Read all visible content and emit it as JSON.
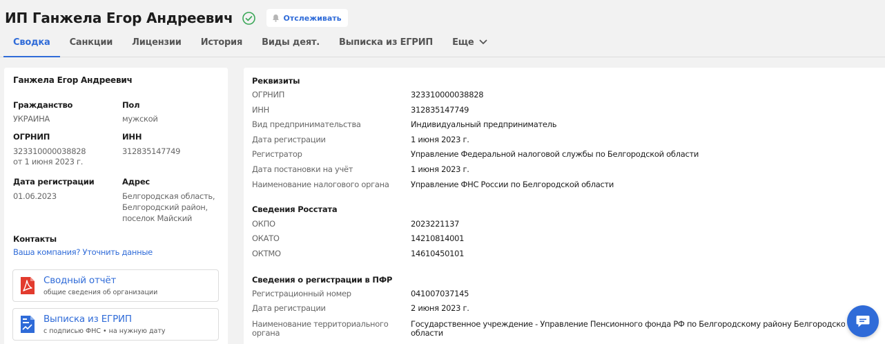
{
  "header": {
    "title": "ИП Ганжела Егор Андреевич",
    "follow_label": "Отслеживать"
  },
  "tabs": [
    {
      "label": "Сводка",
      "active": true
    },
    {
      "label": "Санкции"
    },
    {
      "label": "Лицензии"
    },
    {
      "label": "История"
    },
    {
      "label": "Виды деят."
    },
    {
      "label": "Выписка из ЕГРИП"
    },
    {
      "label": "Еще"
    }
  ],
  "summary": {
    "name": "Ганжела Егор Андреевич",
    "citizenship_label": "Гражданство",
    "citizenship_value": "УКРАИНА",
    "sex_label": "Пол",
    "sex_value": "мужской",
    "ogrnip_label": "ОГРНИП",
    "ogrnip_value": "323310000038828",
    "ogrnip_date": "от 1 июня 2023 г.",
    "inn_label": "ИНН",
    "inn_value": "312835147749",
    "regdate_label": "Дата регистрации",
    "regdate_value": "01.06.2023",
    "address_label": "Адрес",
    "address_lines": [
      "Белгородская область,",
      "Белгородский район,",
      "поселок Майский"
    ],
    "contacts_label": "Контакты",
    "contacts_link": "Ваша компания? Уточнить данные",
    "reports": [
      {
        "title": "Сводный отчёт",
        "subtitle": "общие сведения об организации"
      },
      {
        "title": "Выписка из ЕГРИП",
        "subtitle": "с подписью ФНС • на нужную дату"
      }
    ]
  },
  "details": {
    "requisites": {
      "heading": "Реквизиты",
      "rows": [
        {
          "key": "ОГРНИП",
          "value": "323310000038828"
        },
        {
          "key": "ИНН",
          "value": "312835147749"
        },
        {
          "key": "Вид предпринимательства",
          "value": "Индивидуальный предприниматель"
        },
        {
          "key": "Дата регистрации",
          "value": "1 июня 2023 г."
        },
        {
          "key": "Регистратор",
          "value": "Управление Федеральной налоговой службы по Белгородской области"
        },
        {
          "key": "Дата постановки на учёт",
          "value": "1 июня 2023 г."
        },
        {
          "key": "Наименование налогового органа",
          "value": "Управление ФНС России по Белгородской области"
        }
      ]
    },
    "rosstat": {
      "heading": "Сведения Росстата",
      "rows": [
        {
          "key": "ОКПО",
          "value": "2023221137"
        },
        {
          "key": "ОКАТО",
          "value": "14210814001"
        },
        {
          "key": "ОКТМО",
          "value": "14610450101"
        }
      ]
    },
    "pfr": {
      "heading": "Сведения о регистрации в ПФР",
      "rows": [
        {
          "key": "Регистрационный номер",
          "value": "041007037145"
        },
        {
          "key": "Дата регистрации",
          "value": "2 июня 2023 г."
        },
        {
          "key": "Наименование территориального органа",
          "key_lines": [
            "Наименование территориального",
            "органа"
          ],
          "value_lines": [
            "Государственное учреждение - Управление Пенсионного фонда РФ по Белгородскому району Белгородской",
            "области"
          ]
        }
      ]
    }
  },
  "colors": {
    "accent": "#2f6bd8",
    "verified": "#3aa757",
    "pdf_red": "#e23b2e"
  },
  "icons": {
    "verified": "check-circle-icon",
    "follow": "bell-icon",
    "more": "chevron-down-icon",
    "report1": "pdf-icon",
    "report2": "document-chart-icon",
    "chat": "chat-icon"
  }
}
